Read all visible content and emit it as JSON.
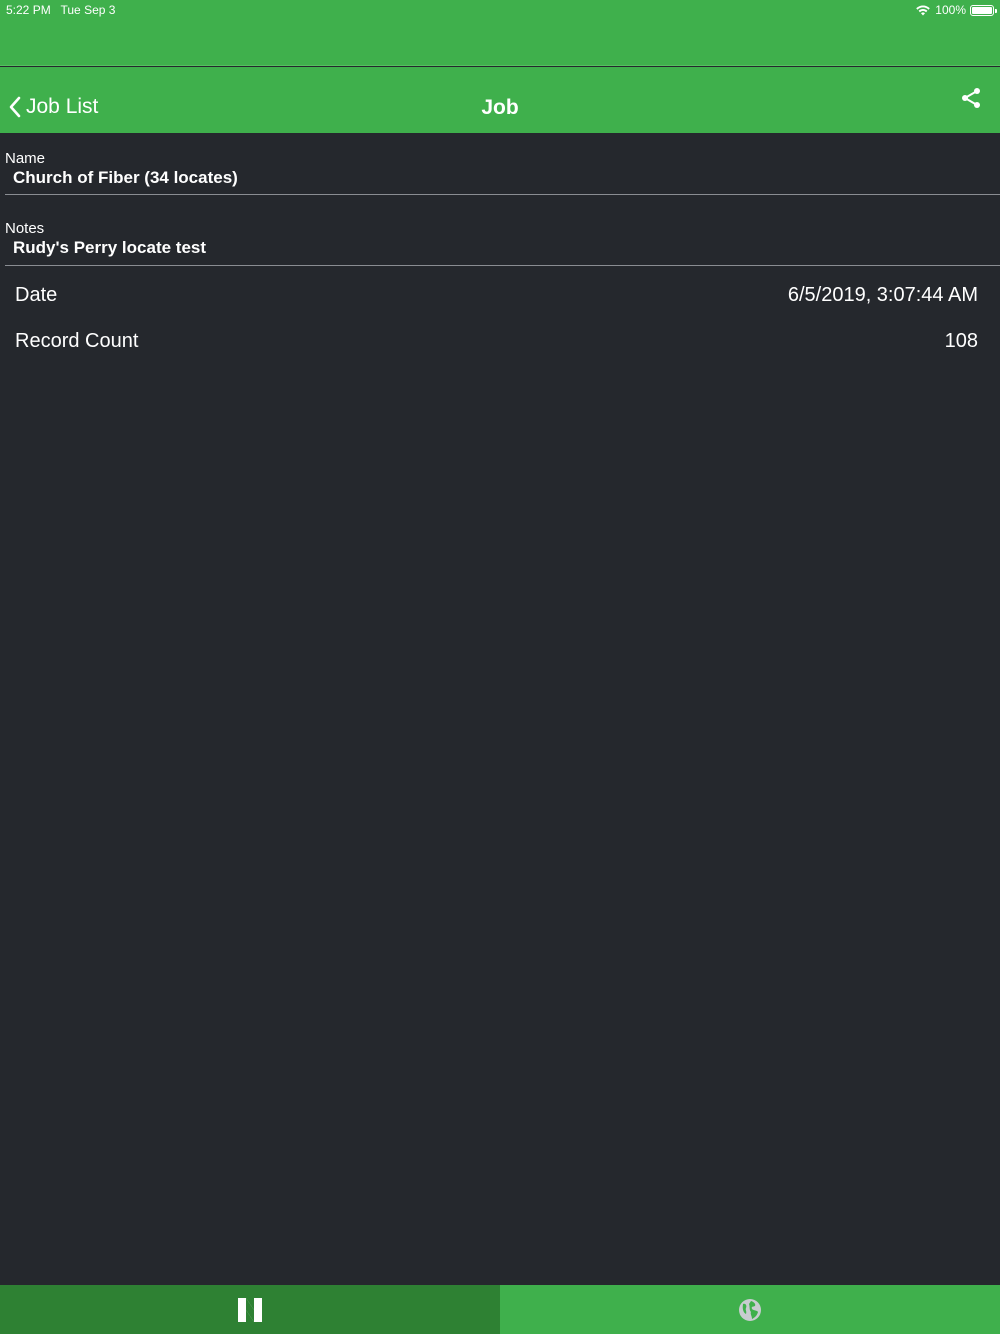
{
  "status_bar": {
    "time": "5:22 PM",
    "date": "Tue Sep 3",
    "battery": "100%"
  },
  "nav": {
    "back_label": "Job List",
    "title": "Job"
  },
  "fields": {
    "name_label": "Name",
    "name_value": "Church of Fiber (34 locates)",
    "notes_label": "Notes",
    "notes_value": "Rudy's Perry locate test"
  },
  "details": [
    {
      "label": "Date",
      "value": "6/5/2019, 3:07:44 AM"
    },
    {
      "label": "Record Count",
      "value": "108"
    }
  ],
  "tabs": [
    {
      "icon": "n-logo-icon",
      "selected": true
    },
    {
      "icon": "globe-icon",
      "selected": false
    }
  ],
  "colors": {
    "accent": "#3fb04c",
    "accent_dark": "#2e8133",
    "background": "#25282d"
  }
}
